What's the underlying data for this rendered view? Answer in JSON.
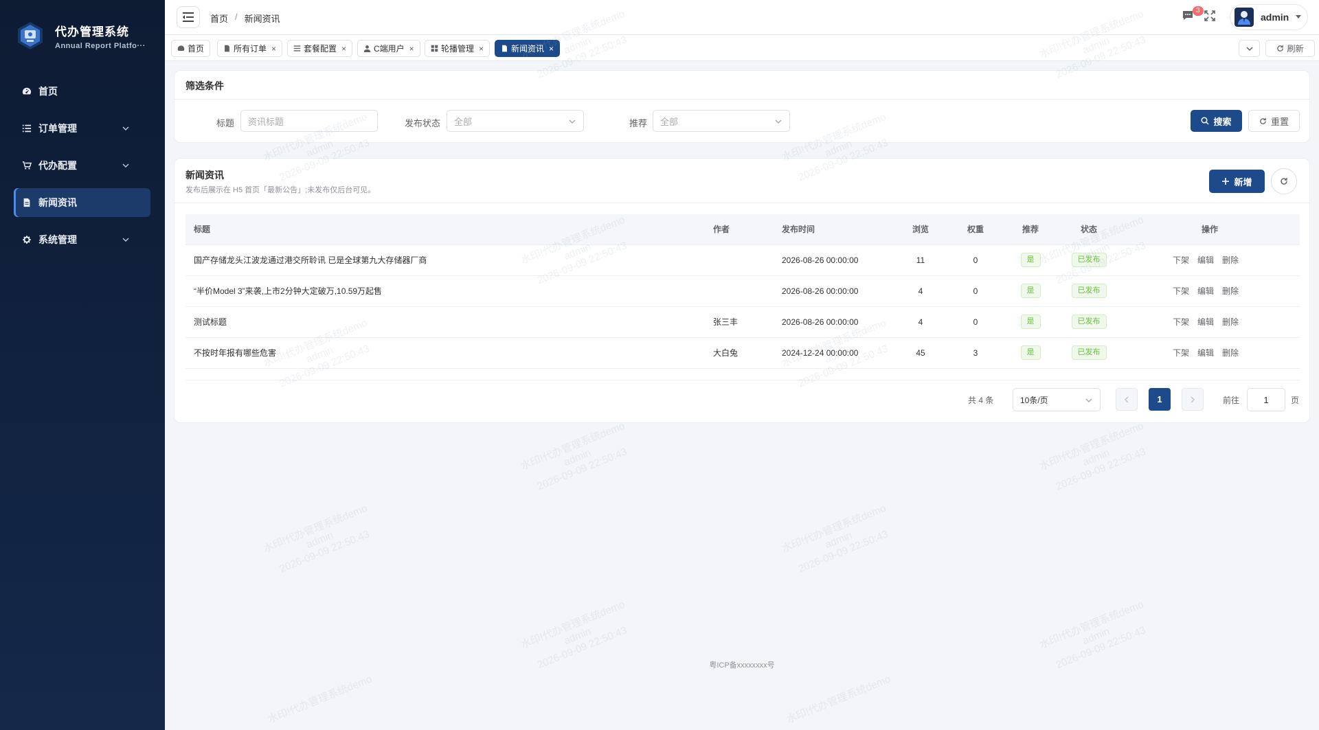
{
  "sidebar": {
    "brand_title": "代办管理系统",
    "brand_subtitle": "Annual Report Platfo···",
    "items": [
      {
        "label": "首页",
        "icon": "dashboard-icon",
        "active": false,
        "has_children": false
      },
      {
        "label": "订单管理",
        "icon": "list-icon",
        "active": false,
        "has_children": true
      },
      {
        "label": "代办配置",
        "icon": "cart-icon",
        "active": false,
        "has_children": true
      },
      {
        "label": "新闻资讯",
        "icon": "document-icon",
        "active": true,
        "has_children": false
      },
      {
        "label": "系统管理",
        "icon": "gear-icon",
        "active": false,
        "has_children": true
      }
    ]
  },
  "header": {
    "breadcrumb": [
      "首页",
      "新闻资讯"
    ],
    "breadcrumb_sep": "/",
    "message_badge": "3",
    "user_name": "admin"
  },
  "tabs": [
    {
      "label": "首页",
      "icon": "dashboard-icon",
      "closable": false,
      "active": false
    },
    {
      "label": "所有订单",
      "icon": "document-icon",
      "closable": true,
      "active": false
    },
    {
      "label": "套餐配置",
      "icon": "list-icon",
      "closable": true,
      "active": false
    },
    {
      "label": "C端用户",
      "icon": "user-icon",
      "closable": true,
      "active": false
    },
    {
      "label": "轮播管理",
      "icon": "grid-icon",
      "closable": true,
      "active": false
    },
    {
      "label": "新闻资讯",
      "icon": "document-icon",
      "closable": true,
      "active": true
    }
  ],
  "tab_refresh_label": "刷新",
  "filter": {
    "title": "筛选条件",
    "title_label": "标题",
    "title_placeholder": "资讯标题",
    "status_label": "发布状态",
    "status_value": "全部",
    "recommend_label": "推荐",
    "recommend_value": "全部",
    "search_label": "搜索",
    "reset_label": "重置"
  },
  "news": {
    "title": "新闻资讯",
    "subtitle": "发布后展示在 H5 首页「最新公告」;未发布仅后台可见。",
    "add_label": "新增",
    "columns": [
      "标题",
      "作者",
      "发布时间",
      "浏览",
      "权重",
      "推荐",
      "状态",
      "操作"
    ],
    "rows": [
      {
        "title": "国产存储龙头江波龙通过港交所聆讯 已是全球第九大存储器厂商",
        "author": "",
        "time": "2026-08-26 00:00:00",
        "views": "11",
        "weight": "0",
        "recommend": "是",
        "status": "已发布"
      },
      {
        "title": "“半价Model 3”来袭,上市2分钟大定破万,10.59万起售",
        "author": "",
        "time": "2026-08-26 00:00:00",
        "views": "4",
        "weight": "0",
        "recommend": "是",
        "status": "已发布"
      },
      {
        "title": "测试标题",
        "author": "张三丰",
        "time": "2026-08-26 00:00:00",
        "views": "4",
        "weight": "0",
        "recommend": "是",
        "status": "已发布"
      },
      {
        "title": "不按时年报有哪些危害",
        "author": "大白兔",
        "time": "2024-12-24 00:00:00",
        "views": "45",
        "weight": "3",
        "recommend": "是",
        "status": "已发布"
      }
    ],
    "actions": [
      "下架",
      "编辑",
      "删除"
    ]
  },
  "pagination": {
    "total": "共 4 条",
    "page_size": "10条/页",
    "current": "1",
    "goto_label": "前往",
    "goto_value": "1",
    "page_suffix": "页"
  },
  "footer": "粤ICP备xxxxxxxx号",
  "watermark": [
    "水印!代办管理系统demo",
    "admin",
    "2026-09-09 22:50:43"
  ],
  "colors": {
    "primary": "#1c4a8a",
    "sidebar": "#0d1b33",
    "success": "#67c23a",
    "danger": "#f56c6c"
  }
}
